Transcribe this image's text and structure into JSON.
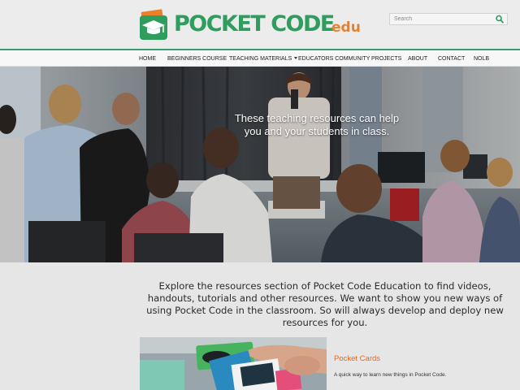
{
  "brand": {
    "logo_main": "POCKET CODE",
    "logo_suffix": "edu",
    "green": "#2e9d5e",
    "orange": "#e8812a"
  },
  "search": {
    "placeholder": "Search",
    "icon": "search-icon"
  },
  "nav": {
    "items": [
      {
        "label": "HOME"
      },
      {
        "label": "BEGINNERS COURSE"
      },
      {
        "label": "TEACHING MATERIALS",
        "has_dropdown": true
      },
      {
        "label": "EDUCATORS COMMUNITY"
      },
      {
        "label": "PROJECTS"
      },
      {
        "label": "ABOUT"
      },
      {
        "label": "CONTACT"
      },
      {
        "label": "NOLB"
      }
    ],
    "accent": "#3a9f70"
  },
  "hero": {
    "caption_line1": "These teaching resources can help",
    "caption_line2": "you and your students in class."
  },
  "intro": {
    "text": "Explore the resources section of Pocket Code Education to find videos, handouts, tutorials and other resources. We want to show you new ways of using Pocket Code in the classroom. So will always develop and deploy new resources for you."
  },
  "cards": [
    {
      "title": "Pocket Cards",
      "description": "A quick way to learn new things in Pocket Code.",
      "title_color": "#e8681e"
    }
  ]
}
